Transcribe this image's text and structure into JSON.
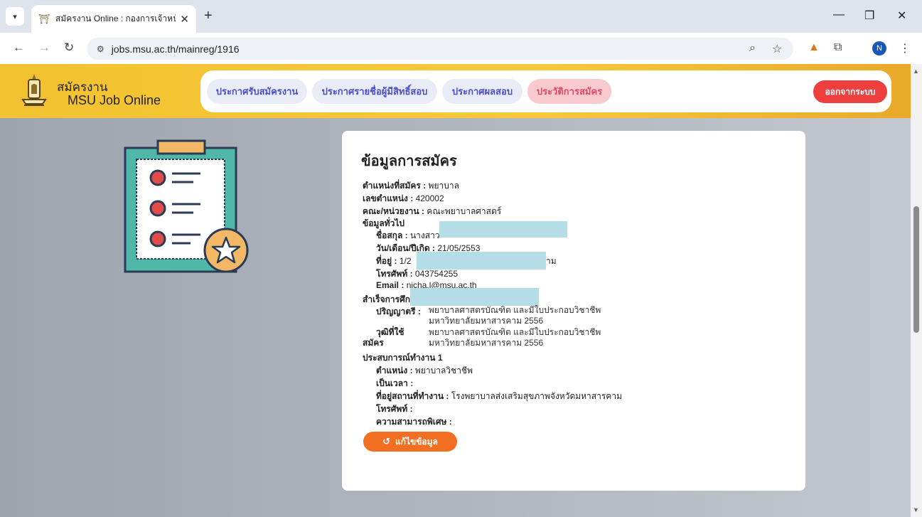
{
  "browser": {
    "tab_title": "สมัครงาน Online : กองการเจ้าหน้าที่",
    "url": "jobs.msu.ac.th/mainreg/1916",
    "profile_initial": "N"
  },
  "header": {
    "brand_line1": "สมัครงาน",
    "brand_line2": "MSU Job Online",
    "nav": [
      {
        "label": "ประกาศรับสมัครงาน"
      },
      {
        "label": "ประกาศรายชื่อผู้มีสิทธิ์สอบ"
      },
      {
        "label": "ประกาศผลสอบ"
      },
      {
        "label": "ประวัติการสมัคร"
      }
    ],
    "logout_label": "ออกจากระบบ"
  },
  "card": {
    "title": "ข้อมูลการสมัคร",
    "position": {
      "label": "ตำแหน่งที่สมัคร :",
      "value": "พยาบาล"
    },
    "position_no": {
      "label": "เลขตำแหน่ง :",
      "value": "420002"
    },
    "faculty": {
      "label": "คณะ/หน่วยงาน :",
      "value": "คณะพยาบาลศาสตร์"
    },
    "general_heading": "ข้อมูลทั่วไป",
    "name": {
      "label": "ชื่อสกุล :",
      "value": "นางสาว"
    },
    "birthdate": {
      "label": "วัน/เดือน/ปีเกิด :",
      "value": "21/05/2553"
    },
    "address": {
      "label": "ที่อยู่ :",
      "value": "1/2",
      "tail": "าม"
    },
    "phone": {
      "label": "โทรศัพท์ :",
      "value": "043754255"
    },
    "email": {
      "label": "Email :",
      "value": "nicha.l@msu.ac.th"
    },
    "education_heading": "สำเร็จการศึก",
    "degree": {
      "label": "ปริญญาตรี :",
      "line1": "พยาบาลศาสตรบัณฑิต และมีใบประกอบวิชาชีพ",
      "line2": "มหาวิทยาลัยมหาสารคาม 2556"
    },
    "qualification": {
      "label_line1": "วุฒิที่ใช้",
      "label_line2": "สมัคร",
      "line1": "พยาบาลศาสตรบัณฑิต และมีใบประกอบวิชาชีพ",
      "line2": "มหาวิทยาลัยมหาสารคาม 2556"
    },
    "experience_heading": "ประสบการณ์ทำงาน 1",
    "exp_position": {
      "label": "ตำแหน่ง :",
      "value": "พยาบาลวิชาชีพ"
    },
    "exp_duration": {
      "label": "เป็นเวลา :",
      "value": ""
    },
    "exp_workplace": {
      "label": "ที่อยู่สถานที่ทำงาน :",
      "value": "โรงพยาบาลส่งเสริมสุขภาพจังหวัดมหาสารคาม"
    },
    "exp_phone": {
      "label": "โทรศัพท์ :",
      "value": ""
    },
    "special_skill": {
      "label": "ความสามารถพิเศษ :",
      "value": ""
    },
    "edit_label": "แก้ไขข้อมูล"
  },
  "colors": {
    "header_yellow": "#f5c232",
    "nav_active": "#f8c9cf",
    "logout_red": "#ee3f3f",
    "edit_orange": "#f26f22",
    "redaction": "#b5dde8"
  }
}
